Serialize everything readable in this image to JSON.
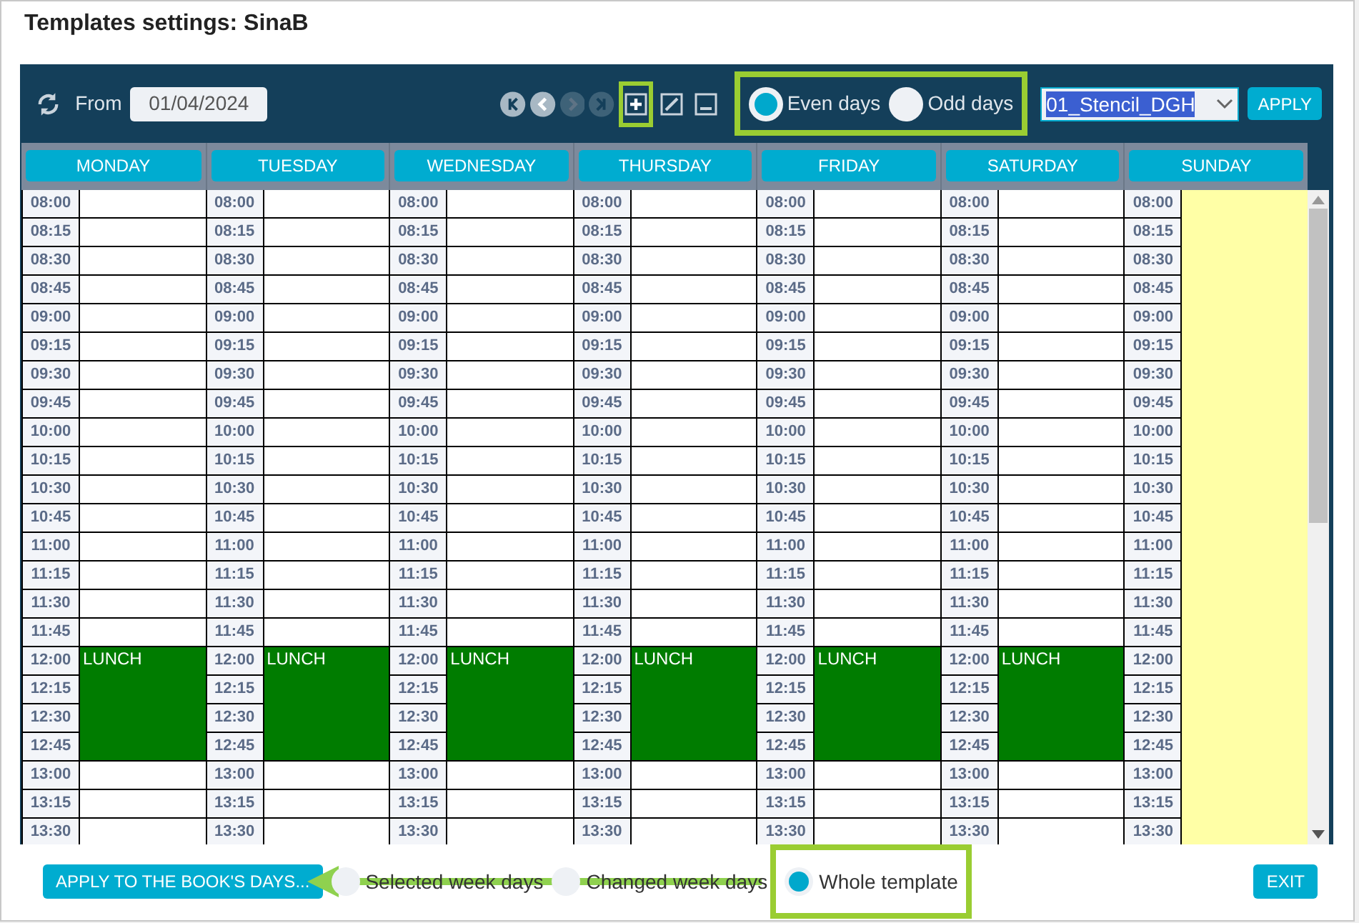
{
  "dialog": {
    "title": "Templates settings: SinaB"
  },
  "toolbar": {
    "from_label": "From",
    "date": "01/04/2024",
    "nav": [
      {
        "kind": "first",
        "disabled": false
      },
      {
        "kind": "prev",
        "disabled": false
      },
      {
        "kind": "next",
        "disabled": true
      },
      {
        "kind": "last",
        "disabled": true
      }
    ],
    "tools": [
      {
        "kind": "add",
        "highlighted": true
      },
      {
        "kind": "edit",
        "highlighted": false
      },
      {
        "kind": "remove",
        "highlighted": false
      }
    ],
    "parity": {
      "highlighted": true,
      "options": [
        {
          "label": "Even days",
          "selected": true
        },
        {
          "label": "Odd days",
          "selected": false
        }
      ]
    },
    "template_select": {
      "value": "01_Stencil_DGH"
    },
    "apply_button": "APPLY"
  },
  "days": [
    {
      "name": "MONDAY",
      "slots": [
        {
          "time": "08:00",
          "kind": "free"
        },
        {
          "time": "08:15",
          "kind": "free"
        },
        {
          "time": "08:30",
          "kind": "free"
        },
        {
          "time": "08:45",
          "kind": "free"
        },
        {
          "time": "09:00",
          "kind": "free"
        },
        {
          "time": "09:15",
          "kind": "free"
        },
        {
          "time": "09:30",
          "kind": "free"
        },
        {
          "time": "09:45",
          "kind": "free"
        },
        {
          "time": "10:00",
          "kind": "free"
        },
        {
          "time": "10:15",
          "kind": "free"
        },
        {
          "time": "10:30",
          "kind": "free"
        },
        {
          "time": "10:45",
          "kind": "free"
        },
        {
          "time": "11:00",
          "kind": "free"
        },
        {
          "time": "11:15",
          "kind": "free"
        },
        {
          "time": "11:30",
          "kind": "free"
        },
        {
          "time": "11:45",
          "kind": "free"
        },
        {
          "time": "12:00",
          "kind": "busy",
          "label": "LUNCH"
        },
        {
          "time": "12:15",
          "kind": "busy"
        },
        {
          "time": "12:30",
          "kind": "busy"
        },
        {
          "time": "12:45",
          "kind": "busy"
        },
        {
          "time": "13:00",
          "kind": "free"
        },
        {
          "time": "13:15",
          "kind": "free"
        },
        {
          "time": "13:30",
          "kind": "free"
        }
      ]
    },
    {
      "name": "TUESDAY",
      "slots": [
        {
          "time": "08:00",
          "kind": "free"
        },
        {
          "time": "08:15",
          "kind": "free"
        },
        {
          "time": "08:30",
          "kind": "free"
        },
        {
          "time": "08:45",
          "kind": "free"
        },
        {
          "time": "09:00",
          "kind": "free"
        },
        {
          "time": "09:15",
          "kind": "free"
        },
        {
          "time": "09:30",
          "kind": "free"
        },
        {
          "time": "09:45",
          "kind": "free"
        },
        {
          "time": "10:00",
          "kind": "free"
        },
        {
          "time": "10:15",
          "kind": "free"
        },
        {
          "time": "10:30",
          "kind": "free"
        },
        {
          "time": "10:45",
          "kind": "free"
        },
        {
          "time": "11:00",
          "kind": "free"
        },
        {
          "time": "11:15",
          "kind": "free"
        },
        {
          "time": "11:30",
          "kind": "free"
        },
        {
          "time": "11:45",
          "kind": "free"
        },
        {
          "time": "12:00",
          "kind": "busy",
          "label": "LUNCH"
        },
        {
          "time": "12:15",
          "kind": "busy"
        },
        {
          "time": "12:30",
          "kind": "busy"
        },
        {
          "time": "12:45",
          "kind": "busy"
        },
        {
          "time": "13:00",
          "kind": "free"
        },
        {
          "time": "13:15",
          "kind": "free"
        },
        {
          "time": "13:30",
          "kind": "free"
        }
      ]
    },
    {
      "name": "WEDNESDAY",
      "slots": [
        {
          "time": "08:00",
          "kind": "free"
        },
        {
          "time": "08:15",
          "kind": "free"
        },
        {
          "time": "08:30",
          "kind": "free"
        },
        {
          "time": "08:45",
          "kind": "free"
        },
        {
          "time": "09:00",
          "kind": "free"
        },
        {
          "time": "09:15",
          "kind": "free"
        },
        {
          "time": "09:30",
          "kind": "free"
        },
        {
          "time": "09:45",
          "kind": "free"
        },
        {
          "time": "10:00",
          "kind": "free"
        },
        {
          "time": "10:15",
          "kind": "free"
        },
        {
          "time": "10:30",
          "kind": "free"
        },
        {
          "time": "10:45",
          "kind": "free"
        },
        {
          "time": "11:00",
          "kind": "free"
        },
        {
          "time": "11:15",
          "kind": "free"
        },
        {
          "time": "11:30",
          "kind": "free"
        },
        {
          "time": "11:45",
          "kind": "free"
        },
        {
          "time": "12:00",
          "kind": "busy",
          "label": "LUNCH"
        },
        {
          "time": "12:15",
          "kind": "busy"
        },
        {
          "time": "12:30",
          "kind": "busy"
        },
        {
          "time": "12:45",
          "kind": "busy"
        },
        {
          "time": "13:00",
          "kind": "free"
        },
        {
          "time": "13:15",
          "kind": "free"
        },
        {
          "time": "13:30",
          "kind": "free"
        }
      ]
    },
    {
      "name": "THURSDAY",
      "slots": [
        {
          "time": "08:00",
          "kind": "free"
        },
        {
          "time": "08:15",
          "kind": "free"
        },
        {
          "time": "08:30",
          "kind": "free"
        },
        {
          "time": "08:45",
          "kind": "free"
        },
        {
          "time": "09:00",
          "kind": "free"
        },
        {
          "time": "09:15",
          "kind": "free"
        },
        {
          "time": "09:30",
          "kind": "free"
        },
        {
          "time": "09:45",
          "kind": "free"
        },
        {
          "time": "10:00",
          "kind": "free"
        },
        {
          "time": "10:15",
          "kind": "free"
        },
        {
          "time": "10:30",
          "kind": "free"
        },
        {
          "time": "10:45",
          "kind": "free"
        },
        {
          "time": "11:00",
          "kind": "free"
        },
        {
          "time": "11:15",
          "kind": "free"
        },
        {
          "time": "11:30",
          "kind": "free"
        },
        {
          "time": "11:45",
          "kind": "free"
        },
        {
          "time": "12:00",
          "kind": "busy",
          "label": "LUNCH"
        },
        {
          "time": "12:15",
          "kind": "busy"
        },
        {
          "time": "12:30",
          "kind": "busy"
        },
        {
          "time": "12:45",
          "kind": "busy"
        },
        {
          "time": "13:00",
          "kind": "free"
        },
        {
          "time": "13:15",
          "kind": "free"
        },
        {
          "time": "13:30",
          "kind": "free"
        }
      ]
    },
    {
      "name": "FRIDAY",
      "slots": [
        {
          "time": "08:00",
          "kind": "free"
        },
        {
          "time": "08:15",
          "kind": "free"
        },
        {
          "time": "08:30",
          "kind": "free"
        },
        {
          "time": "08:45",
          "kind": "free"
        },
        {
          "time": "09:00",
          "kind": "free"
        },
        {
          "time": "09:15",
          "kind": "free"
        },
        {
          "time": "09:30",
          "kind": "free"
        },
        {
          "time": "09:45",
          "kind": "free"
        },
        {
          "time": "10:00",
          "kind": "free"
        },
        {
          "time": "10:15",
          "kind": "free"
        },
        {
          "time": "10:30",
          "kind": "free"
        },
        {
          "time": "10:45",
          "kind": "free"
        },
        {
          "time": "11:00",
          "kind": "free"
        },
        {
          "time": "11:15",
          "kind": "free"
        },
        {
          "time": "11:30",
          "kind": "free"
        },
        {
          "time": "11:45",
          "kind": "free"
        },
        {
          "time": "12:00",
          "kind": "busy",
          "label": "LUNCH"
        },
        {
          "time": "12:15",
          "kind": "busy"
        },
        {
          "time": "12:30",
          "kind": "busy"
        },
        {
          "time": "12:45",
          "kind": "busy"
        },
        {
          "time": "13:00",
          "kind": "free"
        },
        {
          "time": "13:15",
          "kind": "free"
        },
        {
          "time": "13:30",
          "kind": "free"
        }
      ]
    },
    {
      "name": "SATURDAY",
      "slots": [
        {
          "time": "08:00",
          "kind": "free"
        },
        {
          "time": "08:15",
          "kind": "free"
        },
        {
          "time": "08:30",
          "kind": "free"
        },
        {
          "time": "08:45",
          "kind": "free"
        },
        {
          "time": "09:00",
          "kind": "free"
        },
        {
          "time": "09:15",
          "kind": "free"
        },
        {
          "time": "09:30",
          "kind": "free"
        },
        {
          "time": "09:45",
          "kind": "free"
        },
        {
          "time": "10:00",
          "kind": "free"
        },
        {
          "time": "10:15",
          "kind": "free"
        },
        {
          "time": "10:30",
          "kind": "free"
        },
        {
          "time": "10:45",
          "kind": "free"
        },
        {
          "time": "11:00",
          "kind": "free"
        },
        {
          "time": "11:15",
          "kind": "free"
        },
        {
          "time": "11:30",
          "kind": "free"
        },
        {
          "time": "11:45",
          "kind": "free"
        },
        {
          "time": "12:00",
          "kind": "busy",
          "label": "LUNCH"
        },
        {
          "time": "12:15",
          "kind": "busy"
        },
        {
          "time": "12:30",
          "kind": "busy"
        },
        {
          "time": "12:45",
          "kind": "busy"
        },
        {
          "time": "13:00",
          "kind": "free"
        },
        {
          "time": "13:15",
          "kind": "free"
        },
        {
          "time": "13:30",
          "kind": "free"
        }
      ]
    },
    {
      "name": "SUNDAY",
      "slots": [
        {
          "time": "08:00",
          "kind": "off"
        },
        {
          "time": "08:15",
          "kind": "off"
        },
        {
          "time": "08:30",
          "kind": "off"
        },
        {
          "time": "08:45",
          "kind": "off"
        },
        {
          "time": "09:00",
          "kind": "off"
        },
        {
          "time": "09:15",
          "kind": "off"
        },
        {
          "time": "09:30",
          "kind": "off"
        },
        {
          "time": "09:45",
          "kind": "off"
        },
        {
          "time": "10:00",
          "kind": "off"
        },
        {
          "time": "10:15",
          "kind": "off"
        },
        {
          "time": "10:30",
          "kind": "off"
        },
        {
          "time": "10:45",
          "kind": "off"
        },
        {
          "time": "11:00",
          "kind": "off"
        },
        {
          "time": "11:15",
          "kind": "off"
        },
        {
          "time": "11:30",
          "kind": "off"
        },
        {
          "time": "11:45",
          "kind": "off"
        },
        {
          "time": "12:00",
          "kind": "off"
        },
        {
          "time": "12:15",
          "kind": "off"
        },
        {
          "time": "12:30",
          "kind": "off"
        },
        {
          "time": "12:45",
          "kind": "off"
        },
        {
          "time": "13:00",
          "kind": "off"
        },
        {
          "time": "13:15",
          "kind": "off"
        },
        {
          "time": "13:30",
          "kind": "off"
        }
      ]
    }
  ],
  "footer": {
    "apply_books_button": "APPLY TO THE BOOK'S DAYS...",
    "scope": [
      {
        "label": "Selected week days",
        "selected": false,
        "highlighted": false
      },
      {
        "label": "Changed week days",
        "selected": false,
        "highlighted": false
      },
      {
        "label": "Whole template",
        "selected": true,
        "highlighted": true
      }
    ],
    "exit_button": "EXIT"
  }
}
